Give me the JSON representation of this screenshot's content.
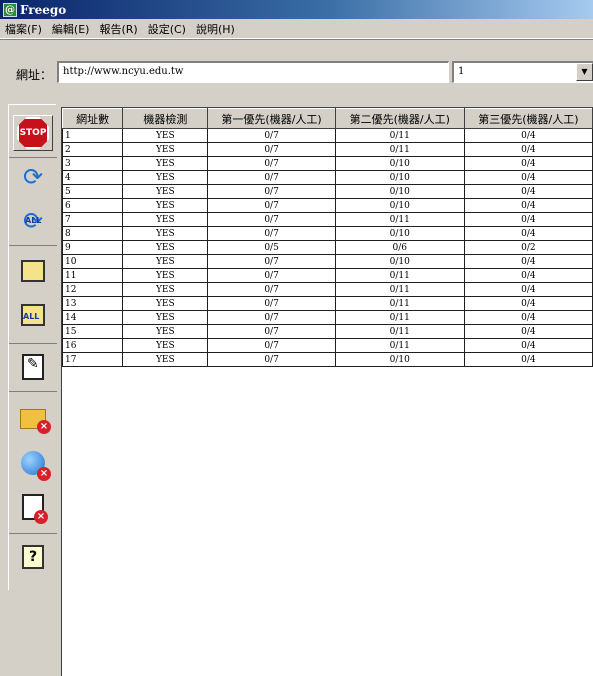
{
  "window": {
    "title": "Freego",
    "app_icon": "@"
  },
  "menu": [
    "檔案(F)",
    "編輯(E)",
    "報告(R)",
    "設定(C)",
    "說明(H)"
  ],
  "address": {
    "label": "網址：",
    "value": "http://www.ncyu.edu.tw",
    "depth_value": "1"
  },
  "toolbar": [
    {
      "name": "stop-button",
      "icon": "stop-icon",
      "label": "STOP"
    },
    {
      "name": "refresh-button",
      "icon": "refresh-icon"
    },
    {
      "name": "refresh-all-button",
      "icon": "refresh-all-icon",
      "label": "ALL"
    },
    {
      "name": "print-button",
      "icon": "printer-icon"
    },
    {
      "name": "print-all-button",
      "icon": "print-all-icon",
      "label": "ALL"
    },
    {
      "name": "edit-button",
      "icon": "edit-icon"
    },
    {
      "name": "delete-folder-button",
      "icon": "folder-delete-icon"
    },
    {
      "name": "delete-web-button",
      "icon": "ie-delete-icon"
    },
    {
      "name": "delete-file-button",
      "icon": "file-delete-icon"
    },
    {
      "name": "help-button",
      "icon": "help-icon",
      "label": "?"
    }
  ],
  "table": {
    "headers": [
      "網址數",
      "機器檢測",
      "第一優先(機器/人工)",
      "第二優先(機器/人工)",
      "第三優先(機器/人工)"
    ],
    "rows": [
      [
        "1",
        "YES",
        "0/7",
        "0/11",
        "0/4"
      ],
      [
        "2",
        "YES",
        "0/7",
        "0/11",
        "0/4"
      ],
      [
        "3",
        "YES",
        "0/7",
        "0/10",
        "0/4"
      ],
      [
        "4",
        "YES",
        "0/7",
        "0/10",
        "0/4"
      ],
      [
        "5",
        "YES",
        "0/7",
        "0/10",
        "0/4"
      ],
      [
        "6",
        "YES",
        "0/7",
        "0/10",
        "0/4"
      ],
      [
        "7",
        "YES",
        "0/7",
        "0/11",
        "0/4"
      ],
      [
        "8",
        "YES",
        "0/7",
        "0/10",
        "0/4"
      ],
      [
        "9",
        "YES",
        "0/5",
        "0/6",
        "0/2"
      ],
      [
        "10",
        "YES",
        "0/7",
        "0/10",
        "0/4"
      ],
      [
        "11",
        "YES",
        "0/7",
        "0/11",
        "0/4"
      ],
      [
        "12",
        "YES",
        "0/7",
        "0/11",
        "0/4"
      ],
      [
        "13",
        "YES",
        "0/7",
        "0/11",
        "0/4"
      ],
      [
        "14",
        "YES",
        "0/7",
        "0/11",
        "0/4"
      ],
      [
        "15",
        "YES",
        "0/7",
        "0/11",
        "0/4"
      ],
      [
        "16",
        "YES",
        "0/7",
        "0/11",
        "0/4"
      ],
      [
        "17",
        "YES",
        "0/7",
        "0/10",
        "0/4"
      ]
    ]
  }
}
